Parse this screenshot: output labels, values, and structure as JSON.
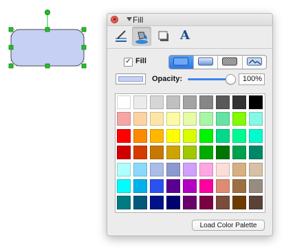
{
  "panel": {
    "title": "Fill",
    "close_glyph": "×",
    "tabs": [
      {
        "name": "line-style-icon",
        "selected": false
      },
      {
        "name": "fill-bucket-icon",
        "selected": true
      },
      {
        "name": "shadow-icon",
        "selected": false
      },
      {
        "name": "text-style-icon",
        "selected": false,
        "glyph": "A"
      }
    ]
  },
  "fill": {
    "checkbox_checked": true,
    "check_glyph": "✓",
    "label": "Fill",
    "fill_types": [
      "solid",
      "gradient",
      "pattern",
      "image"
    ],
    "selected_type": "solid"
  },
  "opacity": {
    "label": "Opacity:",
    "value_text": "100%",
    "value": 1.0,
    "current_color": "#c6d0f5"
  },
  "palette": {
    "colors": [
      "#ffffff",
      "#ebebeb",
      "#d6d6d6",
      "#c0c0c0",
      "#a4a4a4",
      "#868686",
      "#585858",
      "#333333",
      "#000000",
      "#f6a5a5",
      "#fcd3a3",
      "#fde6a5",
      "#fbfba6",
      "#e5fba5",
      "#a6f7a5",
      "#65e2a4",
      "#83fa04",
      "#86f7e4",
      "#fe0000",
      "#fd8801",
      "#ffb600",
      "#fefe00",
      "#d9fd00",
      "#00f400",
      "#03d98a",
      "#00fa91",
      "#00fccd",
      "#d00000",
      "#d63a00",
      "#c87800",
      "#cea300",
      "#a1c700",
      "#00ab00",
      "#007600",
      "#00a04d",
      "#00876a",
      "#aefffd",
      "#8ad9fd",
      "#aabce8",
      "#8b99ce",
      "#d0a1fb",
      "#ffa5e2",
      "#fcddd7",
      "#d7b081",
      "#d7c0a4",
      "#00fefe",
      "#00b1eb",
      "#2a52f0",
      "#590090",
      "#b100c3",
      "#ff00a0",
      "#dd8b73",
      "#9d7043",
      "#988c80",
      "#007b82",
      "#00587a",
      "#00128a",
      "#00006e",
      "#69006c",
      "#7b0043",
      "#7b4b3b",
      "#6d3d00",
      "#5a4236"
    ],
    "load_button_label": "Load Color Palette"
  },
  "canvas_shape": {
    "fill_color": "#c6d0f5",
    "stroke_color": "#4a4a4a",
    "handle_color": "#22c422"
  }
}
